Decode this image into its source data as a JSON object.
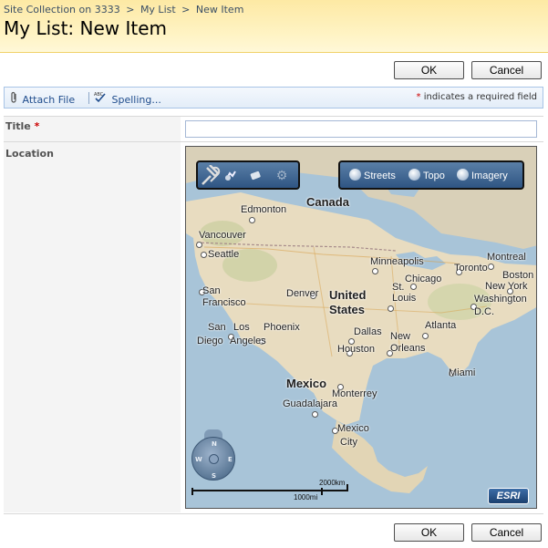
{
  "breadcrumb": {
    "site": "Site Collection on 3333",
    "list": "My List",
    "current": "New Item",
    "separator": ">"
  },
  "page_title": "My List: New Item",
  "buttons": {
    "ok": "OK",
    "cancel": "Cancel"
  },
  "toolbar": {
    "attach": "Attach File",
    "divider": "|",
    "spelling": "Spelling...",
    "required_star": "*",
    "required_note": "indicates a required field"
  },
  "form": {
    "title_label": "Title",
    "title_star": "*",
    "title_value": "",
    "location_label": "Location"
  },
  "map": {
    "basemaps": [
      "Streets",
      "Topo",
      "Imagery"
    ],
    "nav_icons": [
      "tools-icon",
      "pan-icon",
      "eraser-icon",
      "gear-icon"
    ],
    "labels": {
      "canada": "Canada",
      "edmonton": "Edmonton",
      "vancouver": "Vancouver",
      "seattle": "Seattle",
      "minneapolis": "Minneapolis",
      "montreal": "Montreal",
      "toronto": "Toronto",
      "chicago": "Chicago",
      "boston": "Boston",
      "newyork": "New York",
      "washington": "Washington",
      "dc": "D.C.",
      "sanfrancisco_1": "San",
      "sanfrancisco_2": "Francisco",
      "denver": "Denver",
      "us_1": "United",
      "us_2": "States",
      "stlouis_1": "St.",
      "stlouis_2": "Louis",
      "sandiego_1": "San",
      "sandiego_2": "Diego",
      "losangeles_1": "Los",
      "losangeles_2": "Angeles",
      "phoenix": "Phoenix",
      "dallas": "Dallas",
      "atlanta": "Atlanta",
      "houston": "Houston",
      "neworleans_1": "New",
      "neworleans_2": "Orleans",
      "miami": "Miami",
      "mexico": "Mexico",
      "monterrey": "Monterrey",
      "guadalajara": "Guadalajara",
      "mexicocity_1": "Mexico",
      "mexicocity_2": "City"
    },
    "compass": {
      "n": "N",
      "s": "S",
      "e": "E",
      "w": "W"
    },
    "scale": {
      "km": "2000km",
      "mi": "1000mi"
    },
    "attribution": "ESRI"
  },
  "colors": {
    "header_bg": "#fde9a4",
    "link": "#1f4c8c",
    "required": "#c00000",
    "water": "#a8c4d8",
    "land": "#e8dcc0"
  }
}
